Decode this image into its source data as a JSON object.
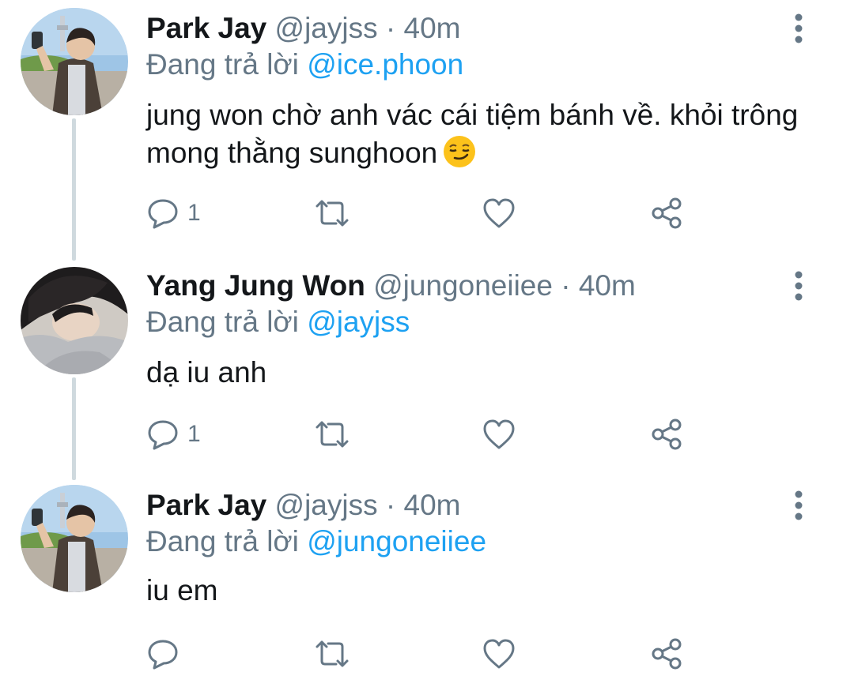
{
  "replying_prefix": "Đang trả lời",
  "colors": {
    "mention": "#1da1f2",
    "secondary": "#657786",
    "thread_line": "#cfd9de",
    "primary_text": "#14171a"
  },
  "tweets": [
    {
      "name": "Park Jay",
      "handle": "@jayjss",
      "sep": "·",
      "time": "40m",
      "reply_to": "@ice.phoon",
      "text": "jung won chờ anh vác cái tiệm bánh về. khỏi trông mong thằng sunghoon",
      "emoji": "smirking-face-emoji",
      "reply_count": "1",
      "icons": [
        "reply-icon",
        "retweet-icon",
        "like-icon",
        "share-icon",
        "more-options-icon"
      ]
    },
    {
      "name": "Yang Jung Won",
      "handle": "@jungoneiiee",
      "sep": "·",
      "time": "40m",
      "reply_to": "@jayjss",
      "text": "dạ iu anh",
      "reply_count": "1",
      "icons": [
        "reply-icon",
        "retweet-icon",
        "like-icon",
        "share-icon",
        "more-options-icon"
      ]
    },
    {
      "name": "Park Jay",
      "handle": "@jayjss",
      "sep": "·",
      "time": "40m",
      "reply_to": "@jungoneiiee",
      "text": "iu em",
      "reply_count": "",
      "icons": [
        "reply-icon",
        "retweet-icon",
        "like-icon",
        "share-icon",
        "more-options-icon"
      ]
    }
  ]
}
